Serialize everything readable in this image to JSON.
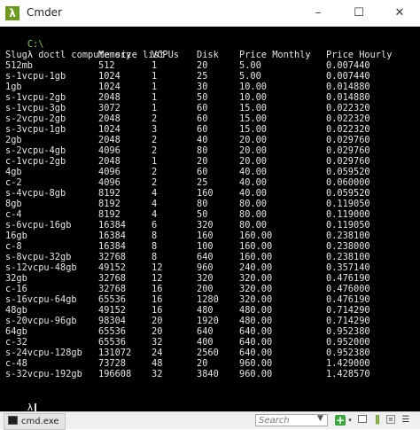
{
  "window": {
    "title": "Cmder",
    "app_icon_glyph": "λ",
    "controls": {
      "minimize": "–",
      "maximize": "☐",
      "close": "✕"
    }
  },
  "console": {
    "prompt_path": "C:\\",
    "prompt_symbol": "λ",
    "command": "doctl compute size list",
    "headers": [
      "Slug",
      "Memory",
      "VCPUs",
      "Disk",
      "Price Monthly",
      "Price Hourly"
    ],
    "rows": [
      [
        "512mb",
        "512",
        "1",
        "20",
        "5.00",
        "0.007440"
      ],
      [
        "s-1vcpu-1gb",
        "1024",
        "1",
        "25",
        "5.00",
        "0.007440"
      ],
      [
        "1gb",
        "1024",
        "1",
        "30",
        "10.00",
        "0.014880"
      ],
      [
        "s-1vcpu-2gb",
        "2048",
        "1",
        "50",
        "10.00",
        "0.014880"
      ],
      [
        "s-1vcpu-3gb",
        "3072",
        "1",
        "60",
        "15.00",
        "0.022320"
      ],
      [
        "s-2vcpu-2gb",
        "2048",
        "2",
        "60",
        "15.00",
        "0.022320"
      ],
      [
        "s-3vcpu-1gb",
        "1024",
        "3",
        "60",
        "15.00",
        "0.022320"
      ],
      [
        "2gb",
        "2048",
        "2",
        "40",
        "20.00",
        "0.029760"
      ],
      [
        "s-2vcpu-4gb",
        "4096",
        "2",
        "80",
        "20.00",
        "0.029760"
      ],
      [
        "c-1vcpu-2gb",
        "2048",
        "1",
        "20",
        "20.00",
        "0.029760"
      ],
      [
        "4gb",
        "4096",
        "2",
        "60",
        "40.00",
        "0.059520"
      ],
      [
        "c-2",
        "4096",
        "2",
        "25",
        "40.00",
        "0.060000"
      ],
      [
        "s-4vcpu-8gb",
        "8192",
        "4",
        "160",
        "40.00",
        "0.059520"
      ],
      [
        "8gb",
        "8192",
        "4",
        "80",
        "80.00",
        "0.119050"
      ],
      [
        "c-4",
        "8192",
        "4",
        "50",
        "80.00",
        "0.119000"
      ],
      [
        "s-6vcpu-16gb",
        "16384",
        "6",
        "320",
        "80.00",
        "0.119050"
      ],
      [
        "16gb",
        "16384",
        "8",
        "160",
        "160.00",
        "0.238100"
      ],
      [
        "c-8",
        "16384",
        "8",
        "100",
        "160.00",
        "0.238000"
      ],
      [
        "s-8vcpu-32gb",
        "32768",
        "8",
        "640",
        "160.00",
        "0.238100"
      ],
      [
        "s-12vcpu-48gb",
        "49152",
        "12",
        "960",
        "240.00",
        "0.357140"
      ],
      [
        "32gb",
        "32768",
        "12",
        "320",
        "320.00",
        "0.476190"
      ],
      [
        "c-16",
        "32768",
        "16",
        "200",
        "320.00",
        "0.476000"
      ],
      [
        "s-16vcpu-64gb",
        "65536",
        "16",
        "1280",
        "320.00",
        "0.476190"
      ],
      [
        "48gb",
        "49152",
        "16",
        "480",
        "480.00",
        "0.714290"
      ],
      [
        "s-20vcpu-96gb",
        "98304",
        "20",
        "1920",
        "480.00",
        "0.714290"
      ],
      [
        "64gb",
        "65536",
        "20",
        "640",
        "640.00",
        "0.952380"
      ],
      [
        "c-32",
        "65536",
        "32",
        "400",
        "640.00",
        "0.952000"
      ],
      [
        "s-24vcpu-128gb",
        "131072",
        "24",
        "2560",
        "640.00",
        "0.952380"
      ],
      [
        "c-48",
        "73728",
        "48",
        "20",
        "960.00",
        "1.429000"
      ],
      [
        "s-32vcpu-192gb",
        "196608",
        "32",
        "3840",
        "960.00",
        "1.428570"
      ]
    ],
    "final_prompt_path": "",
    "final_prompt_symbol": "λ"
  },
  "statusbar": {
    "tab_label": "cmd.exe",
    "search_placeholder": "Search",
    "search_icon": "▼"
  },
  "icons": {
    "add": "+",
    "add_dropdown": "▾",
    "split": "⫼",
    "settings": "≡",
    "menu": "☰"
  },
  "colors": {
    "console_bg": "#000000",
    "console_text": "#e6e6e6",
    "prompt_green": "#7fd14b",
    "accent_green": "#6c9a1f"
  }
}
